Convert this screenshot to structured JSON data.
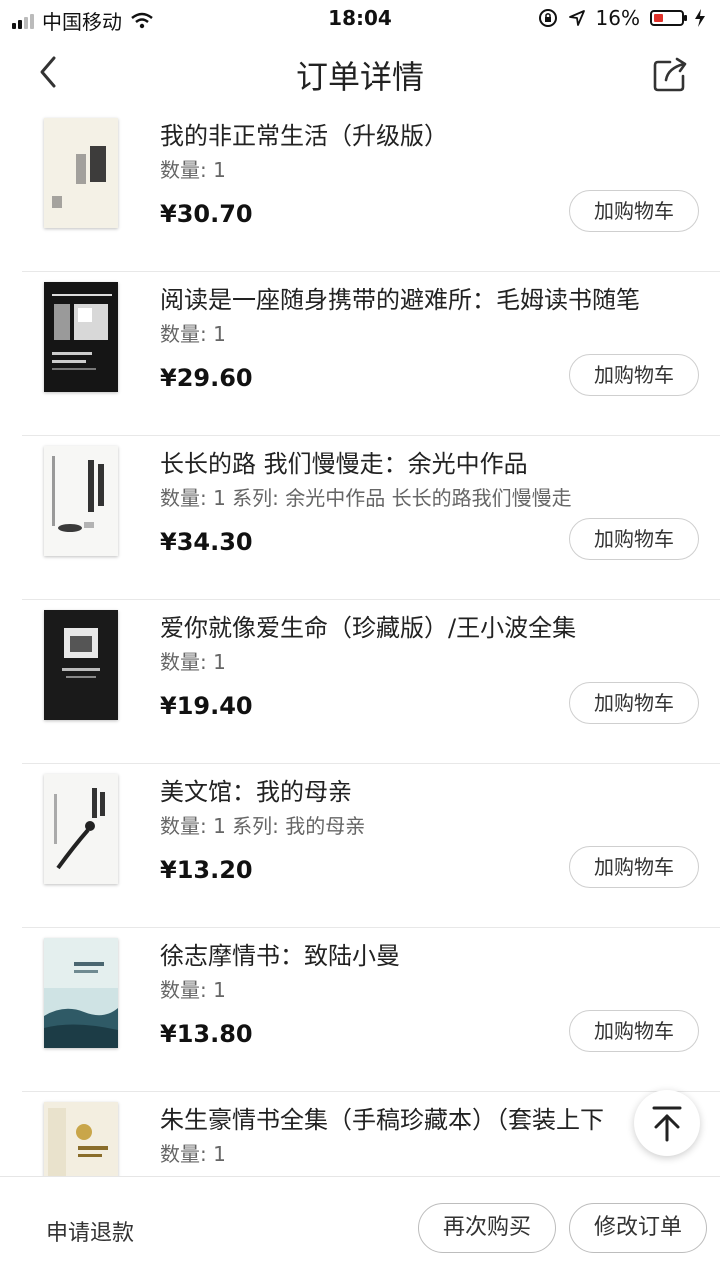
{
  "status_bar": {
    "carrier": "中国移动",
    "time": "18:04",
    "battery_percent": "16%",
    "signal_icon": "signal-bars-icon",
    "wifi_icon": "wifi-icon",
    "lock_icon": "rotation-lock-icon",
    "location_icon": "location-arrow-icon",
    "charging_icon": "charging-bolt-icon",
    "battery_level": 0.16,
    "battery_color": "#e0312a"
  },
  "nav": {
    "title": "订单详情",
    "back_icon": "chevron-left-icon",
    "share_icon": "share-icon"
  },
  "items": [
    {
      "title": "我的非正常生活（升级版）",
      "qty": "数量: 1",
      "price": "¥30.70",
      "cart_label": "加购物车"
    },
    {
      "title": "阅读是一座随身携带的避难所：毛姆读书随笔",
      "qty": "数量: 1",
      "price": "¥29.60",
      "cart_label": "加购物车"
    },
    {
      "title": "长长的路 我们慢慢走：余光中作品",
      "qty": "数量: 1 系列: 余光中作品 长长的路我们慢慢走",
      "price": "¥34.30",
      "cart_label": "加购物车"
    },
    {
      "title": "爱你就像爱生命（珍藏版）/王小波全集",
      "qty": "数量: 1",
      "price": "¥19.40",
      "cart_label": "加购物车"
    },
    {
      "title": "美文馆：我的母亲",
      "qty": "数量: 1 系列: 我的母亲",
      "price": "¥13.20",
      "cart_label": "加购物车"
    },
    {
      "title": "徐志摩情书：致陆小曼",
      "qty": "数量: 1",
      "price": "¥13.80",
      "cart_label": "加购物车"
    },
    {
      "title": "朱生豪情书全集（手稿珍藏本）（套装上下",
      "qty": "数量: 1",
      "price": "",
      "cart_label": ""
    }
  ],
  "back_to_top_icon": "arrow-up-to-top-icon",
  "bottom": {
    "refund_label": "申请退款",
    "rebuy_label": "再次购买",
    "modify_label": "修改订单"
  }
}
